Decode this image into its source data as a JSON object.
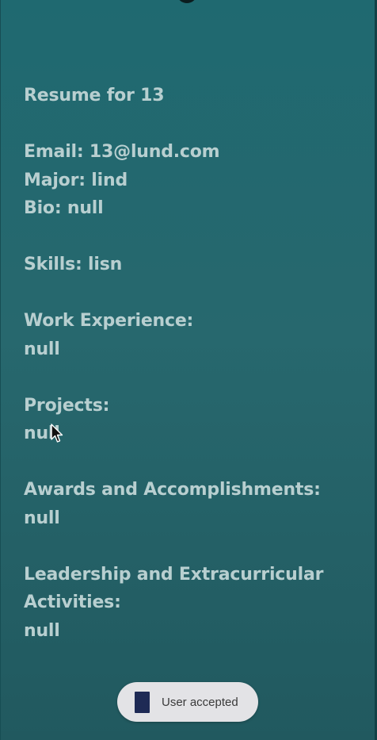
{
  "resume": {
    "title": "Resume for 13",
    "email": "Email: 13@lund.com",
    "major": "Major: lind",
    "bio": "Bio: null",
    "skills": "Skills: lisn",
    "work_experience_heading": "Work Experience:",
    "work_experience_value": "null",
    "projects_heading": "Projects:",
    "projects_value": "null",
    "awards_heading": "Awards and Accomplishments:",
    "awards_value": "null",
    "leadership_heading_line1": "Leadership and Extracurricular",
    "leadership_heading_line2": "Activities:",
    "leadership_value": "null"
  },
  "toast": {
    "icon": "app-icon",
    "message": "User accepted"
  },
  "colors": {
    "background": "#27686e",
    "text": "#b8cfd0",
    "toast_background": "#e3e3e6"
  }
}
